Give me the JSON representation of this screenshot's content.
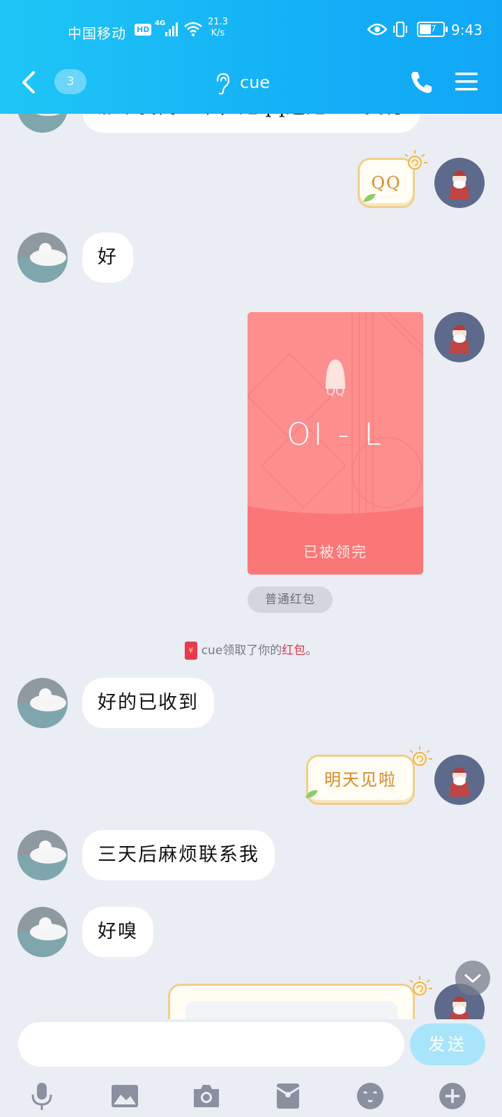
{
  "status_bar": {
    "carrier": "中国移动",
    "hd": "HD",
    "network": "4G",
    "speed_value": "21.3",
    "speed_unit": "K/s",
    "battery": "47",
    "time": "9:43"
  },
  "header": {
    "unread_count": "3",
    "title": "cue"
  },
  "messages": {
    "m0_text": "那个我问一下，是qq还是ZfB支付",
    "m1_sticker": "QQ",
    "m2_text": "好",
    "red_packet": {
      "brand": "QQ",
      "code": "OI - L",
      "status": "已被领完",
      "type_tag": "普通红包"
    },
    "system": {
      "before": "cue领取了你的",
      "highlight": "红包",
      "after": "。"
    },
    "m4_text": "好的已收到",
    "m5_sticker": "明天见啦",
    "m6_text": "三天后麻烦联系我",
    "m7_text": "好嗅"
  },
  "input": {
    "placeholder": "",
    "send_label": "发送"
  },
  "icons": {
    "back": "chevron-left-icon",
    "ear": "ear-icon",
    "phone": "phone-icon",
    "menu": "menu-icon",
    "voice": "microphone-icon",
    "image": "image-icon",
    "camera": "camera-icon",
    "red_packet": "red-packet-icon",
    "emoji": "emoji-icon",
    "plus": "plus-icon",
    "scroll_down": "chevron-down-icon"
  },
  "colors": {
    "header_start": "#1fc6f5",
    "header_end": "#11a7f6",
    "chat_bg": "#eaedf4",
    "red_packet": "#fd8e8e",
    "red_highlight": "#e0344b",
    "send_button": "#a8e5fb"
  }
}
